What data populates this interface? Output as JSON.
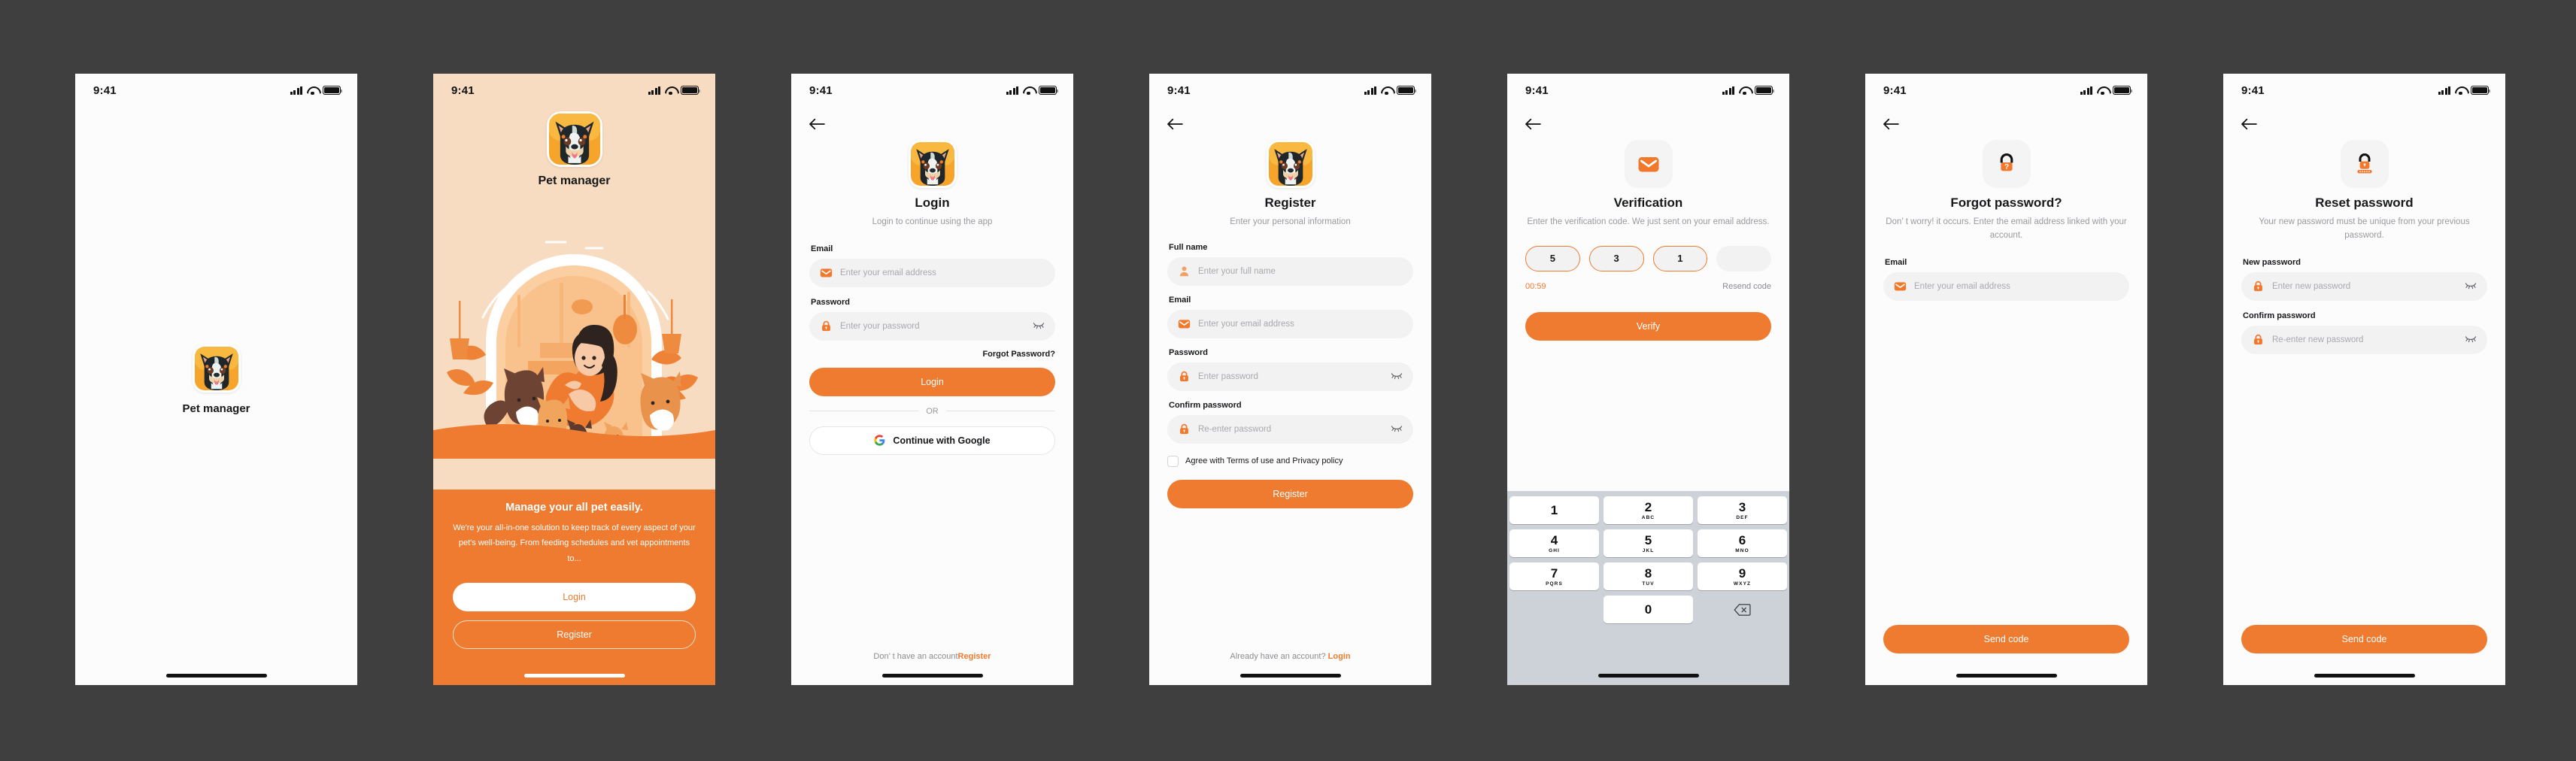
{
  "app": {
    "name": "Pet manager",
    "accent": "#ee7b30",
    "bg_dark": "#3f3f3f",
    "onboard_bg": "#f7dcc2"
  },
  "status_bar": {
    "time": "9:41",
    "signal_icon": "cellular-signal-icon",
    "wifi_icon": "wifi-icon",
    "battery_icon": "battery-icon"
  },
  "screens": {
    "splash": {
      "app_name": "Pet manager",
      "logo_icon": "pet-manager-dog-logo"
    },
    "onboarding": {
      "app_name": "Pet manager",
      "heading": "Manage your all pet easily.",
      "body": "We're your all-in-one solution to keep track of every aspect of your pet's well-being. From feeding schedules and vet appointments to...",
      "login_button": "Login",
      "register_button": "Register",
      "illustration_icon": "woman-with-pets-illustration"
    },
    "login": {
      "title": "Login",
      "subtitle": "Login to continue using the app",
      "email_label": "Email",
      "email_placeholder": "Enter your email address",
      "email_icon": "envelope-icon",
      "password_label": "Password",
      "password_placeholder": "Enter your password",
      "password_icon": "lock-icon",
      "eye_icon": "eye-off-icon",
      "forgot_link": "Forgot Password?",
      "submit_button": "Login",
      "divider": "OR",
      "google_button": "Continue with Google",
      "google_icon": "google-g-icon",
      "footer_text": "Don’ t have an account",
      "footer_link": "Register",
      "back_icon": "arrow-left-icon"
    },
    "register": {
      "title": "Register",
      "subtitle": "Enter your personal information",
      "fullname_label": "Full name",
      "fullname_placeholder": "Enter your full name",
      "fullname_icon": "person-icon",
      "email_label": "Email",
      "email_placeholder": "Enter your email address",
      "email_icon": "envelope-icon",
      "password_label": "Password",
      "password_placeholder": "Enter password",
      "password_icon": "lock-icon",
      "confirm_label": "Confirm password",
      "confirm_placeholder": "Re-enter password",
      "confirm_icon": "lock-icon",
      "eye_icon": "eye-off-icon",
      "agree_text": "Agree with Terms of use and Privacy policy",
      "agree_checked": false,
      "submit_button": "Register",
      "footer_text": "Already have an account?",
      "footer_link": "Login",
      "back_icon": "arrow-left-icon"
    },
    "verification": {
      "title": "Verification",
      "subtitle": "Enter the verification code. We just sent on your email address.",
      "header_icon": "envelope-icon",
      "otp_digits": [
        "5",
        "3",
        "1",
        ""
      ],
      "timer": "00:59",
      "resend": "Resend code",
      "submit_button": "Verify",
      "back_icon": "arrow-left-icon",
      "keypad": [
        {
          "num": "1",
          "letters": ""
        },
        {
          "num": "2",
          "letters": "ABC"
        },
        {
          "num": "3",
          "letters": "DEF"
        },
        {
          "num": "4",
          "letters": "GHI"
        },
        {
          "num": "5",
          "letters": "JKL"
        },
        {
          "num": "6",
          "letters": "MNO"
        },
        {
          "num": "7",
          "letters": "PQRS"
        },
        {
          "num": "8",
          "letters": "TUV"
        },
        {
          "num": "9",
          "letters": "WXYZ"
        },
        {
          "num": "0",
          "letters": ""
        }
      ],
      "delete_icon": "backspace-icon"
    },
    "forgot_password": {
      "title": "Forgot password?",
      "subtitle": "Don’ t worry! it occurs. Enter the email address linked with your account.",
      "header_icon": "lock-question-icon",
      "email_label": "Email",
      "email_placeholder": "Enter your email address",
      "email_icon": "envelope-icon",
      "submit_button": "Send code",
      "back_icon": "arrow-left-icon"
    },
    "reset_password": {
      "title": "Reset password",
      "subtitle": "Your new password must be unique from your previous password.",
      "header_icon": "lock-reset-icon",
      "new_label": "New password",
      "new_placeholder": "Enter new password",
      "new_icon": "lock-icon",
      "confirm_label": "Confirm password",
      "confirm_placeholder": "Re-enter new password",
      "confirm_icon": "lock-icon",
      "eye_icon": "eye-off-icon",
      "submit_button": "Send code",
      "back_icon": "arrow-left-icon"
    }
  }
}
